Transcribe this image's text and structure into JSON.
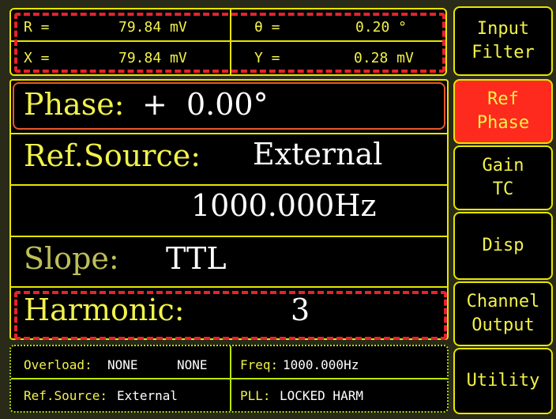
{
  "readout": {
    "r_label": "R =",
    "r_value": "79.84 mV",
    "theta_label": "θ =",
    "theta_value": "0.20 °",
    "x_label": "X =",
    "x_value": "79.84 mV",
    "y_label": "Y =",
    "y_value": "0.28 mV"
  },
  "main": {
    "phase_label": "Phase:",
    "phase_value": "+  0.00°",
    "ref_source_label": "Ref.Source:",
    "ref_source_value": "External",
    "frequency_value": "1000.000Hz",
    "slope_label": "Slope:",
    "slope_value": "TTL",
    "harmonic_label": "Harmonic:",
    "harmonic_value": "3"
  },
  "status": {
    "overload_label": "Overload:",
    "overload_value1": "NONE",
    "overload_value2": "NONE",
    "freq_label": "Freq:",
    "freq_value": "1000.000Hz",
    "ref_source_label": "Ref.Source:",
    "ref_source_value": "External",
    "pll_label": "PLL:",
    "pll_value": "LOCKED HARM"
  },
  "softkeys": [
    {
      "line1": "Input",
      "line2": "Filter"
    },
    {
      "line1": "Ref",
      "line2": "Phase"
    },
    {
      "line1": "Gain",
      "line2": "TC"
    },
    {
      "line1": "Disp",
      "line2": ""
    },
    {
      "line1": "Channel",
      "line2": "Output"
    },
    {
      "line1": "Utility",
      "line2": ""
    }
  ],
  "colors": {
    "border": "#e6e600",
    "text_primary": "#f2f24a",
    "text_value": "#ffffff",
    "active_softkey": "#ff2a1e",
    "highlight_dash": "#e8222a",
    "frame_bg": "#2a2a18"
  }
}
